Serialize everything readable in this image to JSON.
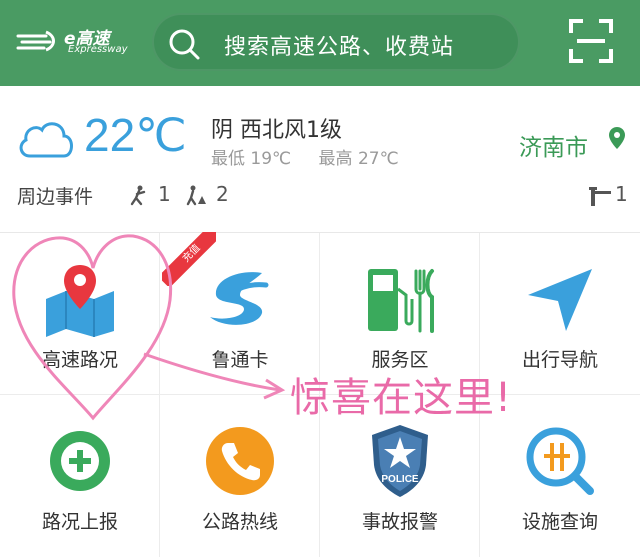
{
  "header": {
    "logo_text": "e高速",
    "logo_sub": "Expressway",
    "search_placeholder": "搜索高速公路、收费站",
    "icons": [
      "search-icon",
      "scan-icon"
    ],
    "background_color": "#4a9b63"
  },
  "weather": {
    "temperature": "22℃",
    "condition": "阴 西北风1级",
    "low_label": "最低 19℃",
    "high_label": "最高 27℃",
    "city": "济南市",
    "temperature_color": "#3aa0dc",
    "city_color": "#3b9a57"
  },
  "events": {
    "label": "周边事件",
    "items": [
      {
        "icon": "construction-icon",
        "count": "1"
      },
      {
        "icon": "road-work-icon",
        "count": "2"
      },
      {
        "icon": "toll-gate-icon",
        "count": "1"
      }
    ]
  },
  "grid": {
    "items": [
      {
        "label": "高速路况",
        "icon": "road-map-icon"
      },
      {
        "label": "鲁通卡",
        "icon": "lutong-card-icon",
        "badge": "充值"
      },
      {
        "label": "服务区",
        "icon": "service-area-icon"
      },
      {
        "label": "出行导航",
        "icon": "navigation-icon"
      },
      {
        "label": "路况上报",
        "icon": "report-plus-icon"
      },
      {
        "label": "公路热线",
        "icon": "phone-icon"
      },
      {
        "label": "事故报警",
        "icon": "police-badge-icon",
        "badge_text": "POLICE"
      },
      {
        "label": "设施查询",
        "icon": "facility-search-icon"
      }
    ]
  },
  "annotation": {
    "text": "惊喜在这里!",
    "color": "#e96aa8"
  }
}
